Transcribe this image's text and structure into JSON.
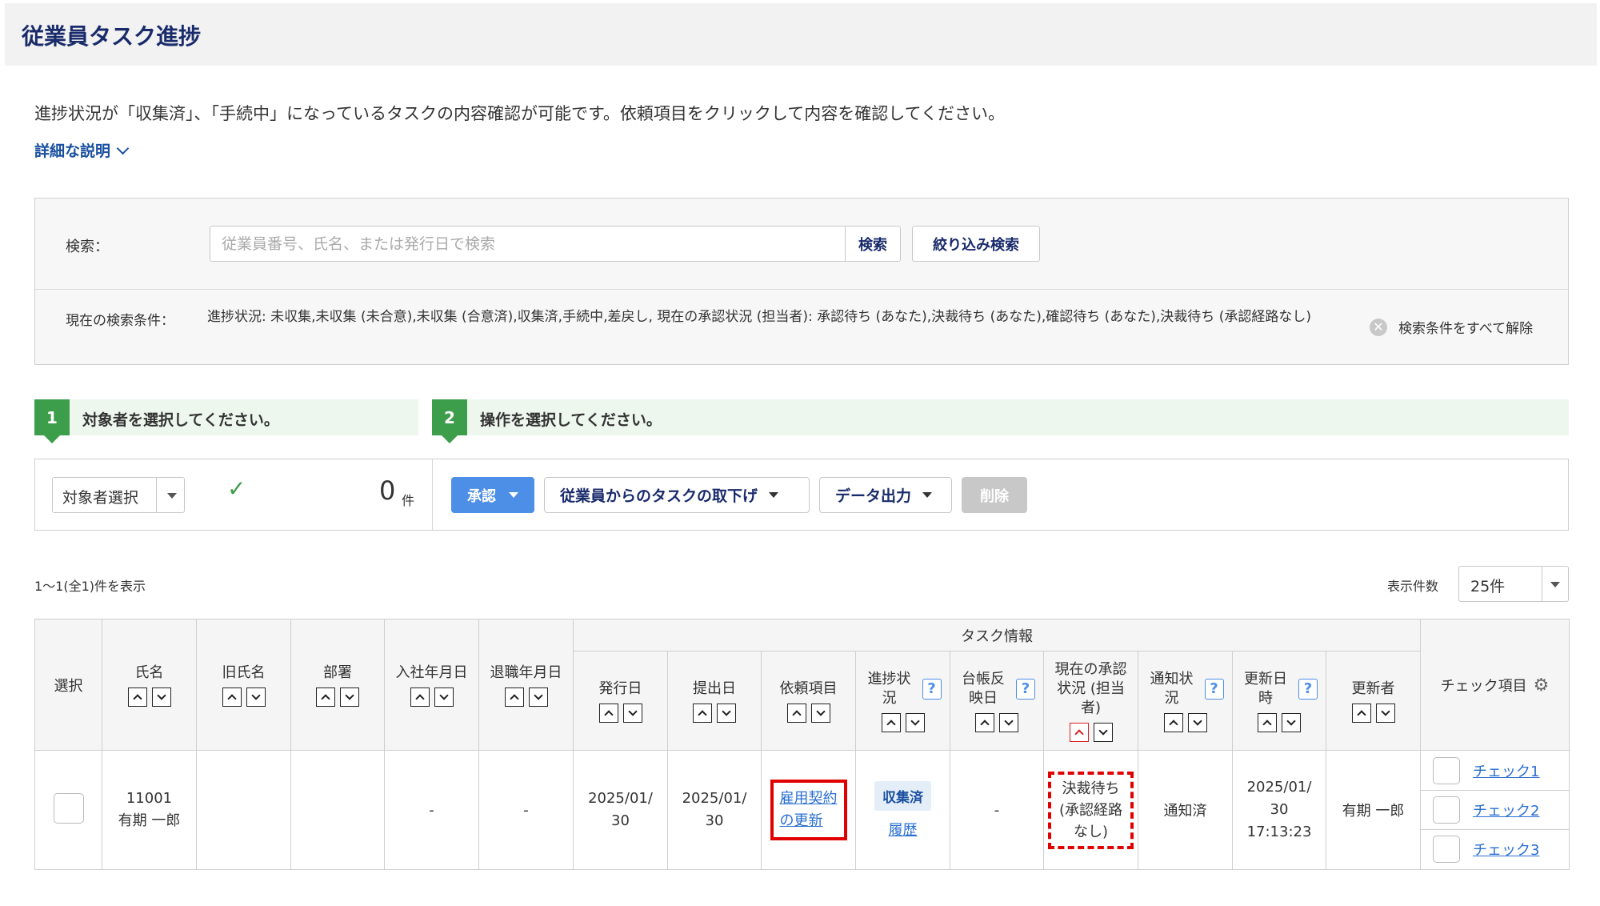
{
  "header": {
    "title": "従業員タスク進捗"
  },
  "description": "進捗状況が「収集済」、「手続中」になっているタスクの内容確認が可能です。依頼項目をクリックして内容を確認してください。",
  "detail_link": "詳細な説明",
  "search": {
    "label": "検索：",
    "placeholder": "従業員番号、氏名、または発行日で検索",
    "search_button": "検索",
    "filter_button": "絞り込み検索",
    "conditions_label": "現在の検索条件：",
    "conditions_text": "進捗状況: 未収集,未収集 (未合意),未収集 (合意済),収集済,手続中,差戻し, 現在の承認状況 (担当者): 承認待ち (あなた),決裁待ち (あなた),確認待ち (あなた),決裁待ち (承認経路なし)",
    "clear_all": "検索条件をすべて解除"
  },
  "steps": [
    {
      "num": "1",
      "text": "対象者を選択してください。"
    },
    {
      "num": "2",
      "text": "操作を選択してください。"
    }
  ],
  "operations": {
    "target_select": "対象者選択",
    "count": "0",
    "count_unit": "件",
    "approve": "承認",
    "withdraw": "従業員からのタスクの取下げ",
    "export": "データ出力",
    "delete": "削除"
  },
  "results": {
    "count_text": "1〜1(全1)件を表示",
    "page_size_label": "表示件数",
    "page_size": "25件"
  },
  "table": {
    "group_header": "タスク情報",
    "headers": {
      "select": "選択",
      "name": "氏名",
      "old_name": "旧氏名",
      "dept": "部署",
      "join_date": "入社年月日",
      "leave_date": "退職年月日",
      "issue_date": "発行日",
      "submit_date": "提出日",
      "request_item": "依頼項目",
      "progress": "進捗状況",
      "ledger": "台帳反映日",
      "approval": "現在の承認状況 (担当者)",
      "notify": "通知状況",
      "updated_at": "更新日時",
      "updated_by": "更新者",
      "check_items": "チェック項目"
    },
    "row": {
      "emp_no": "11001",
      "name": "有期 一郎",
      "old_name": "",
      "dept": "",
      "join_date": "-",
      "leave_date": "-",
      "issue_date_1": "2025/01/",
      "issue_date_2": "30",
      "submit_date_1": "2025/01/",
      "submit_date_2": "30",
      "request_item_1": "雇用契約",
      "request_item_2": "の更新",
      "progress_badge": "収集済",
      "history_link": "履歴",
      "ledger": "-",
      "approval_1": "決裁待ち",
      "approval_2": "(承認経路",
      "approval_3": "なし)",
      "notify": "通知済",
      "updated_at_1": "2025/01/",
      "updated_at_2": "30",
      "updated_at_3": "17:13:23",
      "updated_by": "有期 一郎",
      "checks": [
        "チェック1",
        "チェック2",
        "チェック3"
      ]
    }
  },
  "colors": {
    "title": "#1a2b6b",
    "step_green": "#3c9d4a",
    "primary_blue": "#4d8ee6",
    "highlight_red": "#e00000"
  },
  "icons": {
    "chevron": "chevron-down-icon",
    "clear": "clear-circle-icon",
    "check": "check-icon",
    "help": "help-icon",
    "gear": "gear-icon",
    "sort_up": "sort-asc-icon",
    "sort_down": "sort-desc-icon"
  }
}
